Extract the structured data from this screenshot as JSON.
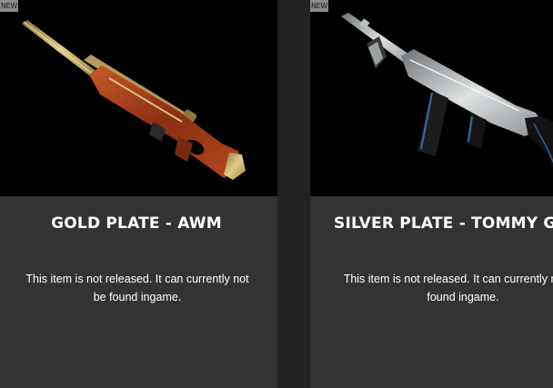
{
  "cards": [
    {
      "badge": "NEW",
      "title": "GOLD PLATE - AWM",
      "description": "This item is not released. It can currently not be found ingame.",
      "image_icon": "awm-sniper-rifle-icon"
    },
    {
      "badge": "NEW",
      "title": "SILVER PLATE - TOMMY GUN",
      "description": "This item is not released. It can currently not be found ingame.",
      "image_icon": "tommy-gun-icon"
    }
  ],
  "colors": {
    "page_background": "#222222",
    "card_background": "#333333",
    "image_background": "#000000",
    "badge_background": "#8a8a8a",
    "text": "#ffffff",
    "gold": "#c9b06a",
    "wood": "#9a3a18",
    "silver": "#b9bcbd"
  }
}
